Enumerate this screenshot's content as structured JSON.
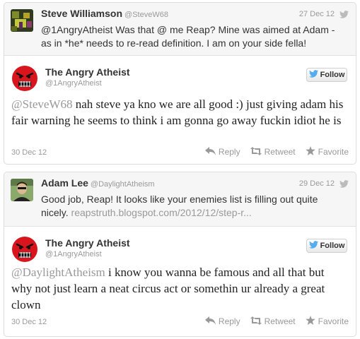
{
  "tweets": [
    {
      "reply": {
        "name": "Steve Williamson",
        "handle": "@SteveW68",
        "date": "27 Dec 12",
        "text": "@1AngryAtheist Was that @ me Reap? Mine was aimed at Adam - as in *he* needs to re-read definition. I am on your side fella!",
        "link": ""
      },
      "main": {
        "name": "The Angry Atheist",
        "handle": "@1AngryAtheist",
        "follow_label": "Follow",
        "mention": "@SteveW68",
        "text": " nah steve ya kno we are all good :) just giving adam his fair warning he seems to think i am gonna go away fuckin idiot he is",
        "date": "30 Dec 12"
      }
    },
    {
      "reply": {
        "name": "Adam Lee",
        "handle": "@DaylightAtheism",
        "date": "29 Dec 12",
        "text": "Good job, Reap! It looks like your enemies list is filling out quite nicely. ",
        "link": "reapstruth.blogspot.com/2012/12/step-r..."
      },
      "main": {
        "name": "The Angry Atheist",
        "handle": "@1AngryAtheist",
        "follow_label": "Follow",
        "mention": "@DaylightAtheism",
        "text": " i know you wanna be famous and all that but why not just learn a neat circus act or somethin ur already a great clown",
        "date": "30 Dec 12"
      }
    }
  ],
  "actions": {
    "reply": "Reply",
    "retweet": "Retweet",
    "favorite": "Favorite"
  },
  "colors": {
    "twitter_blue": "#55acee",
    "muted": "#999999",
    "angry_red": "#d8151c"
  },
  "icons": [
    "twitter-bird-icon",
    "reply-arrow-icon",
    "retweet-icon",
    "favorite-star-icon"
  ]
}
